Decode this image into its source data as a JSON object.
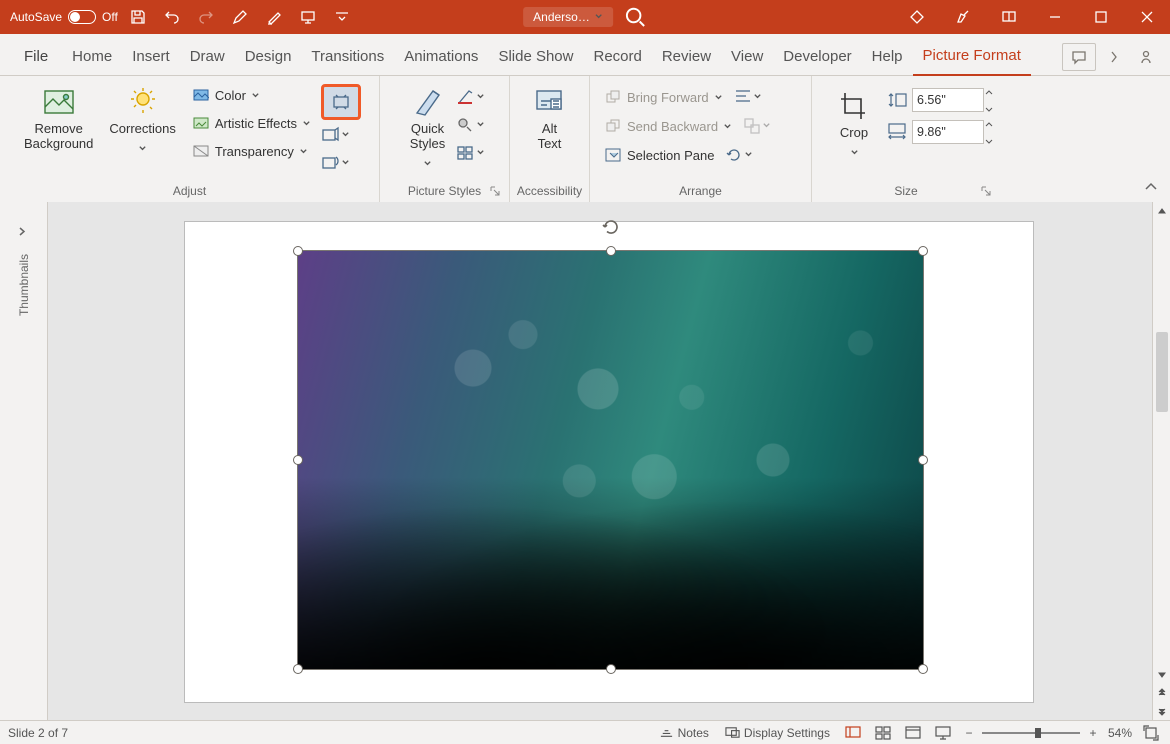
{
  "titlebar": {
    "autosave_label": "AutoSave",
    "autosave_state": "Off",
    "doc_name": "Anderso…"
  },
  "tabs": {
    "file": "File",
    "items": [
      "Home",
      "Insert",
      "Draw",
      "Design",
      "Transitions",
      "Animations",
      "Slide Show",
      "Record",
      "Review",
      "View",
      "Developer",
      "Help",
      "Picture Format"
    ],
    "active": "Picture Format"
  },
  "ribbon": {
    "adjust": {
      "remove_bg": "Remove\nBackground",
      "corrections": "Corrections",
      "color": "Color",
      "artistic": "Artistic Effects",
      "transparency": "Transparency",
      "group_label": "Adjust"
    },
    "picture_styles": {
      "quick": "Quick\nStyles",
      "group_label": "Picture Styles"
    },
    "accessibility": {
      "alt": "Alt\nText",
      "group_label": "Accessibility"
    },
    "arrange": {
      "bring_forward": "Bring Forward",
      "send_backward": "Send Backward",
      "selection_pane": "Selection Pane",
      "group_label": "Arrange"
    },
    "size": {
      "crop": "Crop",
      "height": "6.56\"",
      "width": "9.86\"",
      "group_label": "Size"
    }
  },
  "thumbnails_label": "Thumbnails",
  "statusbar": {
    "slide": "Slide 2 of 7",
    "notes": "Notes",
    "display": "Display Settings",
    "zoom": "54%"
  }
}
